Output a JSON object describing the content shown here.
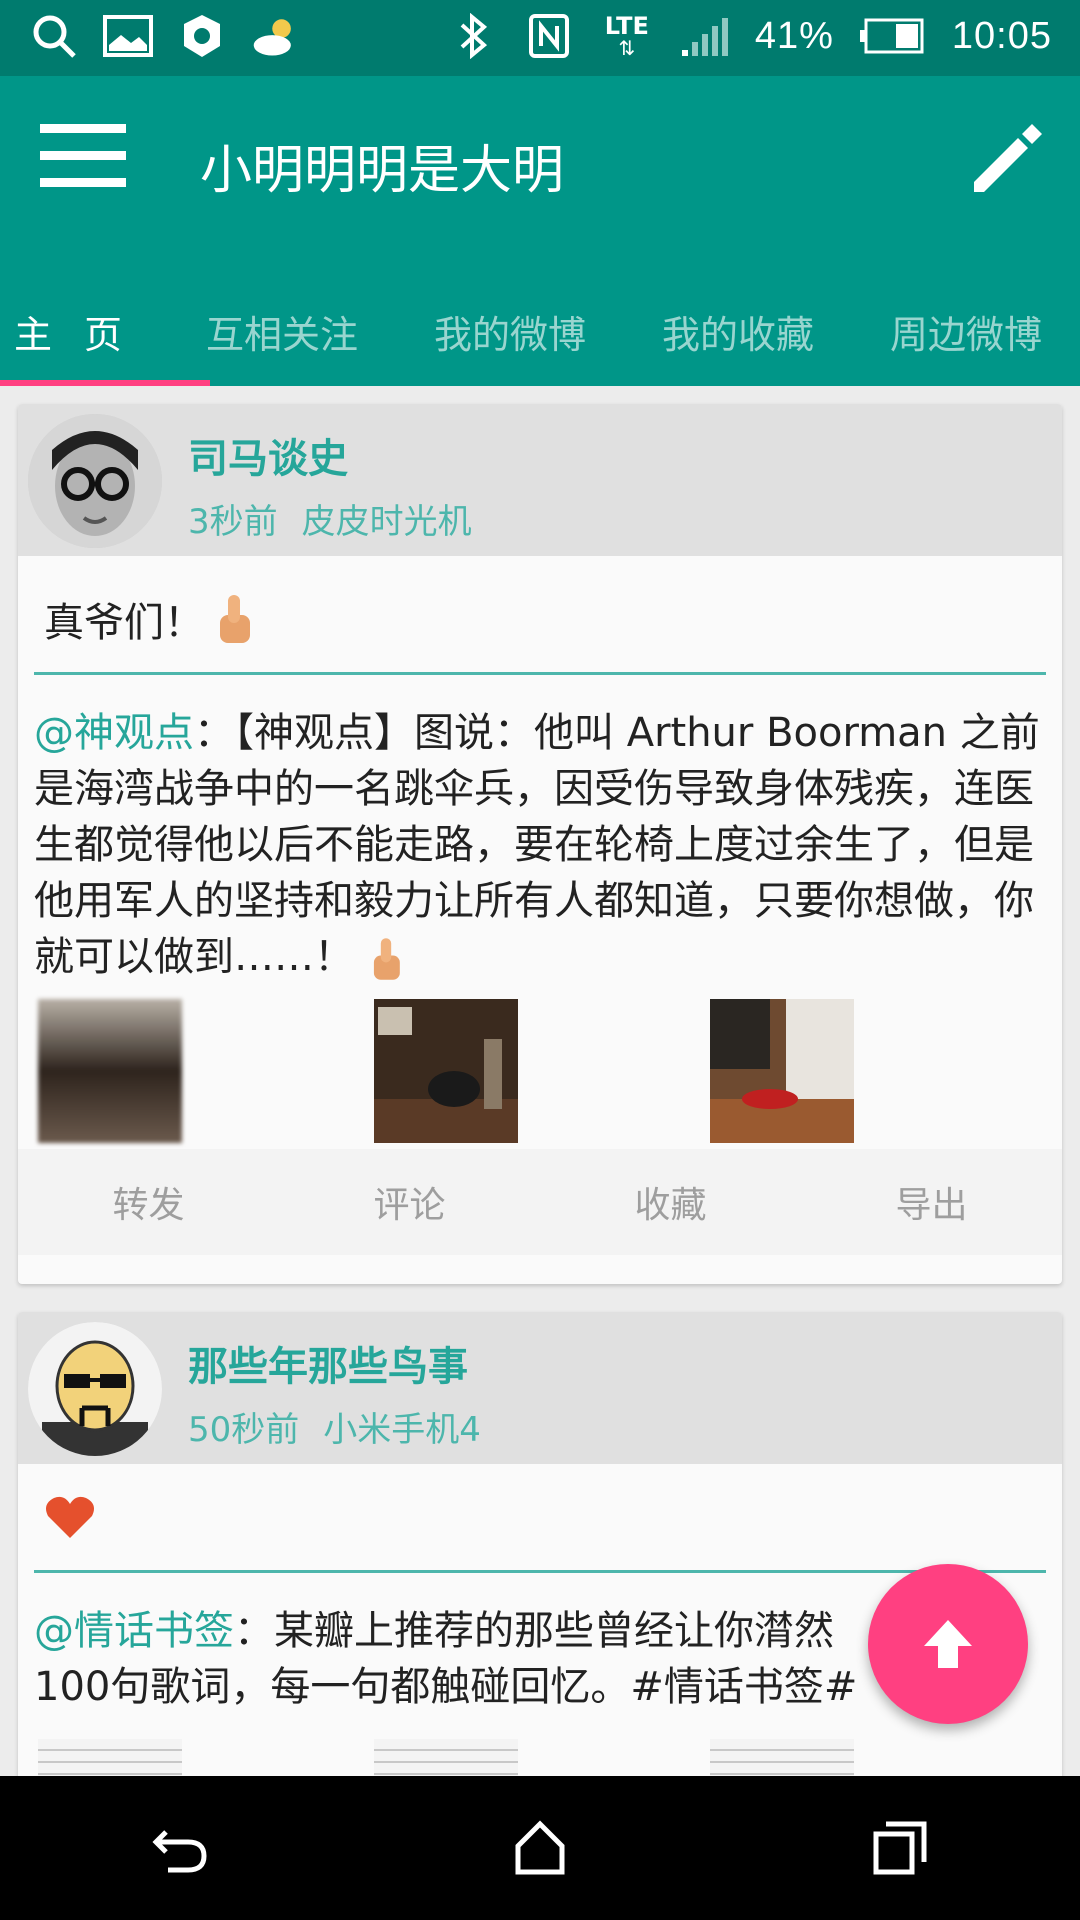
{
  "status_bar": {
    "battery": "41%",
    "time": "10:05",
    "network": "LTE",
    "left_icons": [
      "search-icon",
      "photo-icon",
      "settings-icon",
      "weather-icon"
    ],
    "right_icons": [
      "bluetooth-icon",
      "nfc-icon",
      "lte-icon",
      "signal-icon",
      "battery-icon"
    ]
  },
  "app_bar": {
    "title": "小明明明是大明",
    "menu_icon": "hamburger-icon",
    "action_icon": "edit-icon"
  },
  "tabs": [
    "主页",
    "互相关注",
    "我的微博",
    "我的收藏",
    "周边微博"
  ],
  "active_tab": 0,
  "posts": [
    {
      "author": "司马谈史",
      "time": "3秒前",
      "source": "皮皮时光机",
      "text": "真爷们！",
      "emoji": "thumbs-up-icon",
      "repost_author": "@神观点",
      "repost_text": "：【神观点】图说：他叫 Arthur Boorman 之前是海湾战争中的一名跳伞兵，因受伤导致身体残疾，连医生都觉得他以后不能走路，要在轮椅上度过余生了，但是他用军人的坚持和毅力让所有人都知道，只要你想做，你就可以做到……！",
      "actions": [
        "转发",
        "评论",
        "收藏",
        "导出"
      ]
    },
    {
      "author": "那些年那些鸟事",
      "time": "50秒前",
      "source": "小米手机4",
      "emoji": "heart-icon",
      "repost_author": "@情话书签",
      "repost_text": "：某瓣上推荐的那些曾经让你潸然",
      "repost_text_line2": "100句歌词，每一句都触碰回忆。#情话书签#"
    }
  ],
  "fab_icon": "arrow-up-icon",
  "nav": [
    "back-icon",
    "home-icon",
    "recents-icon"
  ],
  "colors": {
    "primary": "#009688",
    "status": "#007b6e",
    "accent": "#ff4081",
    "teal_text": "#26a69a"
  }
}
